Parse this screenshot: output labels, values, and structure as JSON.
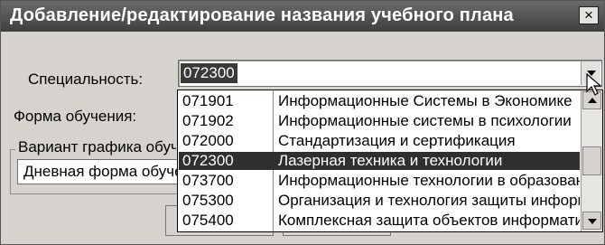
{
  "window": {
    "title": "Добавление/редактирование названия  учебного плана",
    "close_glyph": "×"
  },
  "form": {
    "specialty_label": "Специальность:",
    "specialty_value": "072300",
    "study_form_label": "Форма обучения:",
    "schedule_group_label": "Вариант графика обучения",
    "schedule_value": "Дневная форма обучения"
  },
  "dropdown": {
    "items": [
      {
        "code": "071901",
        "name": "Информационные Системы в Экономике"
      },
      {
        "code": "071902",
        "name": "Информационные системы в психологии"
      },
      {
        "code": "072000",
        "name": "Стандартизация и сертификация"
      },
      {
        "code": "072300",
        "name": "Лазерная техника и технологии",
        "selected": true
      },
      {
        "code": "073700",
        "name": "Информационные технологии в образовании"
      },
      {
        "code": "075300",
        "name": "Организация и технология защиты информации"
      },
      {
        "code": "075400",
        "name": "Комплексная защита объектов информатизации"
      }
    ]
  },
  "icons": {
    "combo_arrow": "chevron-down-icon",
    "scroll_up": "arrow-up-icon",
    "scroll_down": "arrow-down-icon",
    "pointer": "mouse-pointer-icon"
  }
}
